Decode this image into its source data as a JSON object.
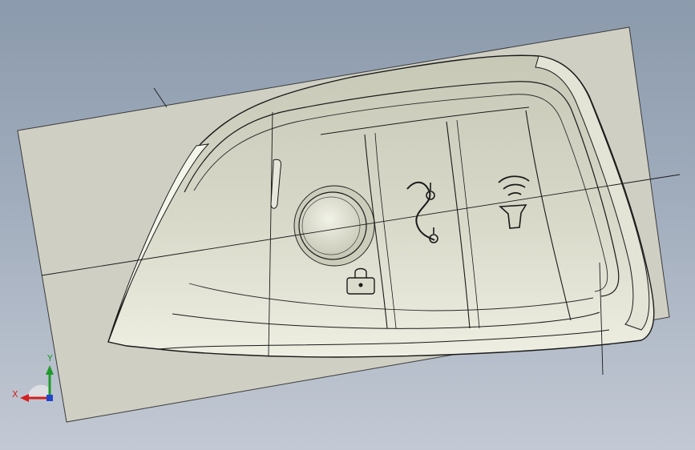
{
  "viewer": {
    "background_top": "#8b9aac",
    "background_bottom": "#c3c9d4",
    "model_face_color": "#d4d5c4",
    "model_highlight_color": "#f1f2e6",
    "edge_color": "#111111"
  },
  "triad": {
    "x_label": "X",
    "y_label": "Y",
    "x_color": "#d42020",
    "y_color": "#1e9a2a",
    "z_color": "#2244cc"
  },
  "model": {
    "icons": [
      "lock-icon",
      "trunk-release-icon",
      "horn-icon",
      "unlock-button-icon"
    ]
  }
}
